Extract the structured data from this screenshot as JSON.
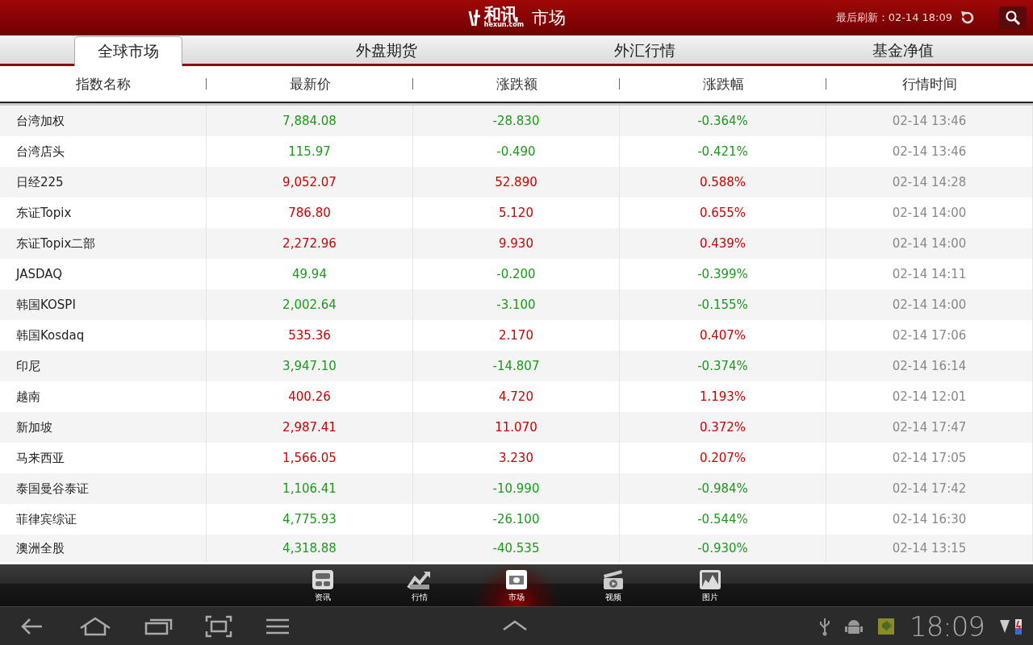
{
  "header": {
    "logo_text": "和讯",
    "logo_sub": "hexun.com",
    "title": "市场",
    "refresh_label": "最后刷新：02-14 18:09"
  },
  "tabs": [
    {
      "label": "全球市场",
      "selected": true
    },
    {
      "label": "外盘期货",
      "selected": false
    },
    {
      "label": "外汇行情",
      "selected": false
    },
    {
      "label": "基金净值",
      "selected": false
    }
  ],
  "table": {
    "columns": [
      "指数名称",
      "最新价",
      "涨跌额",
      "涨跌幅",
      "行情时间"
    ],
    "rows": [
      {
        "name": "台湾加权",
        "price": "7,884.08",
        "change": "-28.830",
        "percent": "-0.364%",
        "time": "02-14 13:46",
        "color": "#1a9a1a"
      },
      {
        "name": "台湾店头",
        "price": "115.97",
        "change": "-0.490",
        "percent": "-0.421%",
        "time": "02-14 13:46",
        "color": "#1a9a1a"
      },
      {
        "name": "日经225",
        "price": "9,052.07",
        "change": "52.890",
        "percent": "0.588%",
        "time": "02-14 14:28",
        "color": "#cc0000"
      },
      {
        "name": "东证Topix",
        "price": "786.80",
        "change": "5.120",
        "percent": "0.655%",
        "time": "02-14 14:00",
        "color": "#cc0000"
      },
      {
        "name": "东证Topix二部",
        "price": "2,272.96",
        "change": "9.930",
        "percent": "0.439%",
        "time": "02-14 14:00",
        "color": "#cc0000"
      },
      {
        "name": "JASDAQ",
        "price": "49.94",
        "change": "-0.200",
        "percent": "-0.399%",
        "time": "02-14 14:11",
        "color": "#1a9a1a"
      },
      {
        "name": "韩国KOSPI",
        "price": "2,002.64",
        "change": "-3.100",
        "percent": "-0.155%",
        "time": "02-14 14:00",
        "color": "#1a9a1a"
      },
      {
        "name": "韩国Kosdaq",
        "price": "535.36",
        "change": "2.170",
        "percent": "0.407%",
        "time": "02-14 17:06",
        "color": "#cc0000"
      },
      {
        "name": "印尼",
        "price": "3,947.10",
        "change": "-14.807",
        "percent": "-0.374%",
        "time": "02-14 16:14",
        "color": "#1a9a1a"
      },
      {
        "name": "越南",
        "price": "400.26",
        "change": "4.720",
        "percent": "1.193%",
        "time": "02-14 12:01",
        "color": "#cc0000"
      },
      {
        "name": "新加坡",
        "price": "2,987.41",
        "change": "11.070",
        "percent": "0.372%",
        "time": "02-14 17:47",
        "color": "#cc0000"
      },
      {
        "name": "马来西亚",
        "price": "1,566.05",
        "change": "3.230",
        "percent": "0.207%",
        "time": "02-14 17:05",
        "color": "#cc0000"
      },
      {
        "name": "泰国曼谷泰证",
        "price": "1,106.41",
        "change": "-10.990",
        "percent": "-0.984%",
        "time": "02-14 17:42",
        "color": "#1a9a1a"
      },
      {
        "name": "菲律宾综证",
        "price": "4,775.93",
        "change": "-26.100",
        "percent": "-0.544%",
        "time": "02-14 16:30",
        "color": "#1a9a1a"
      },
      {
        "name": "澳洲全股",
        "price": "4,318.88",
        "change": "-40.535",
        "percent": "-0.930%",
        "time": "02-14 13:15",
        "color": "#1a9a1a"
      }
    ]
  },
  "bottom_nav": [
    {
      "label": "资讯",
      "selected": false
    },
    {
      "label": "行情",
      "selected": false
    },
    {
      "label": "市场",
      "selected": true
    },
    {
      "label": "视频",
      "selected": false
    },
    {
      "label": "图片",
      "selected": false
    }
  ],
  "system_bar": {
    "clock": "18:09"
  }
}
